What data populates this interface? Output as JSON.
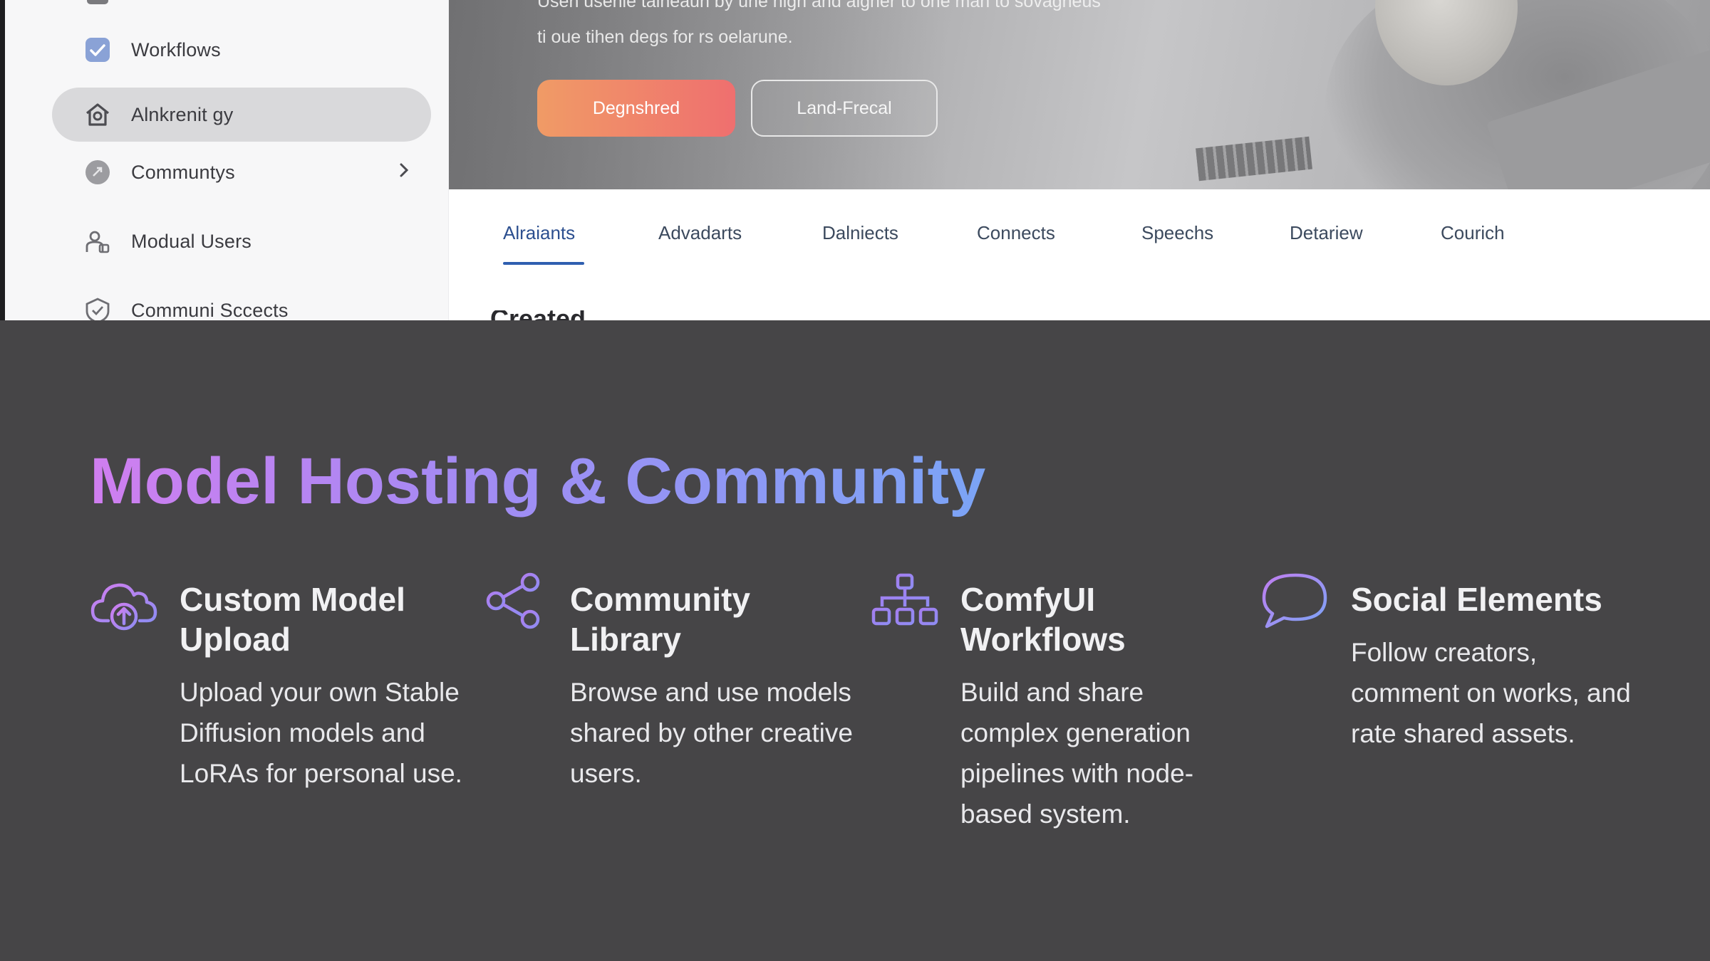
{
  "screenshot": {
    "sidebar": {
      "items": [
        {
          "label": "Workflows",
          "icon": "checkbox-icon",
          "active": false,
          "has_chevron": false
        },
        {
          "label": "Alnkrenit gy",
          "icon": "house-icon",
          "active": true,
          "has_chevron": false
        },
        {
          "label": "Communtys",
          "icon": "community-circle-icon",
          "active": false,
          "has_chevron": true
        },
        {
          "label": "Modual Users",
          "icon": "users-icon",
          "active": false,
          "has_chevron": false
        },
        {
          "label": "Communi Sccects",
          "icon": "shield-icon",
          "active": false,
          "has_chevron": false
        }
      ]
    },
    "hero": {
      "text_line1": "Usen usenie talneaun by une nign and algner to one man to sovagneus",
      "text_line2": "ti oue tihen degs for rs oelarune.",
      "primary_button": "Degnshred",
      "secondary_button": "Land-Frecal"
    },
    "tabs": [
      "Alraiants",
      "Advadarts",
      "Dalniects",
      "Connects",
      "Speechs",
      "Detariew",
      "Courich"
    ],
    "active_tab": "Alraiants",
    "cut_heading": "Created At..."
  },
  "section": {
    "title": "Model Hosting & Community",
    "features": [
      {
        "icon": "cloud-upload-icon",
        "title": "Custom Model Upload",
        "description": "Upload your own Stable Diffusion models and LoRAs for personal use."
      },
      {
        "icon": "share-icon",
        "title": "Community Library",
        "description": "Browse and use models shared by other creative users."
      },
      {
        "icon": "workflow-tree-icon",
        "title": "ComfyUI Workflows",
        "description": "Build and share complex generation pipelines with node-based system."
      },
      {
        "icon": "chat-bubble-icon",
        "title": "Social Elements",
        "description": "Follow creators, comment on works, and rate shared assets."
      }
    ]
  },
  "colors": {
    "background": "#464547",
    "title_gradient_start": "#d07ef0",
    "title_gradient_end": "#7ba4f6",
    "primary_button_start": "#f09b66",
    "primary_button_end": "#ef6f6f",
    "active_tab": "#2f5fb0"
  }
}
